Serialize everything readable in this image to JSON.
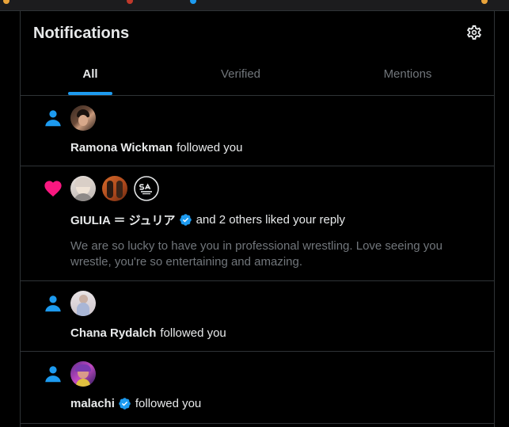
{
  "header": {
    "title": "Notifications",
    "settings_icon": "gear-icon"
  },
  "tabs": [
    {
      "label": "All",
      "active": true
    },
    {
      "label": "Verified",
      "active": false
    },
    {
      "label": "Mentions",
      "active": false
    }
  ],
  "notifications": [
    {
      "type": "follow",
      "icon": "person-icon",
      "name": "Ramona Wickman",
      "verified": false,
      "text": "followed you"
    },
    {
      "type": "like",
      "icon": "heart-icon",
      "name": "GIULIA ＝ ジュリア",
      "verified": true,
      "text": "and 2 others liked your reply",
      "preview": "We are so lucky to have you in professional wrestling. Love seeing you wrestle, you're so entertaining and amazing.",
      "avatar_badge": "SA SPORT"
    },
    {
      "type": "follow",
      "icon": "person-icon",
      "name": "Chana Rydalch",
      "verified": false,
      "text": "followed you"
    },
    {
      "type": "follow",
      "icon": "person-icon",
      "name": "malachi",
      "verified": true,
      "text": "followed you"
    }
  ],
  "colors": {
    "background": "#000000",
    "accent": "#1d9bf0",
    "like": "#f91880",
    "muted": "#71767b",
    "border": "#2f3336"
  }
}
